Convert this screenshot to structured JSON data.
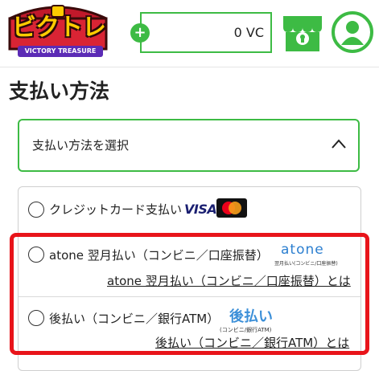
{
  "header": {
    "logo_text": "ビクトレ",
    "logo_subtitle": "VICTORY TREASURE",
    "wallet_plus": "+",
    "wallet_balance": "0 VC",
    "accent_color": "#3dbb44",
    "icons": [
      "plus-icon",
      "shop-icon",
      "user-icon"
    ]
  },
  "page": {
    "title": "支払い方法"
  },
  "select": {
    "label": "支払い方法を選択",
    "state": "expanded",
    "icon": "chevron-up-icon"
  },
  "methods": [
    {
      "label": "クレジットカード支払い",
      "brands": [
        "VISA",
        "mastercard"
      ],
      "selected": false
    },
    {
      "label": "atone 翌月払い（コンビニ／口座振替）",
      "logo_word": "atone",
      "logo_caption": "翌月払い(コンビニ/口座振替)",
      "link": "atone 翌月払い（コンビニ／口座振替）とは",
      "selected": false
    },
    {
      "label": "後払い（コンビニ／銀行ATM）",
      "logo_word": "後払い",
      "logo_caption": "(コンビニ/銀行ATM)",
      "link": "後払い（コンビニ／銀行ATM）とは",
      "selected": false
    }
  ],
  "highlight_color": "#e8141a"
}
